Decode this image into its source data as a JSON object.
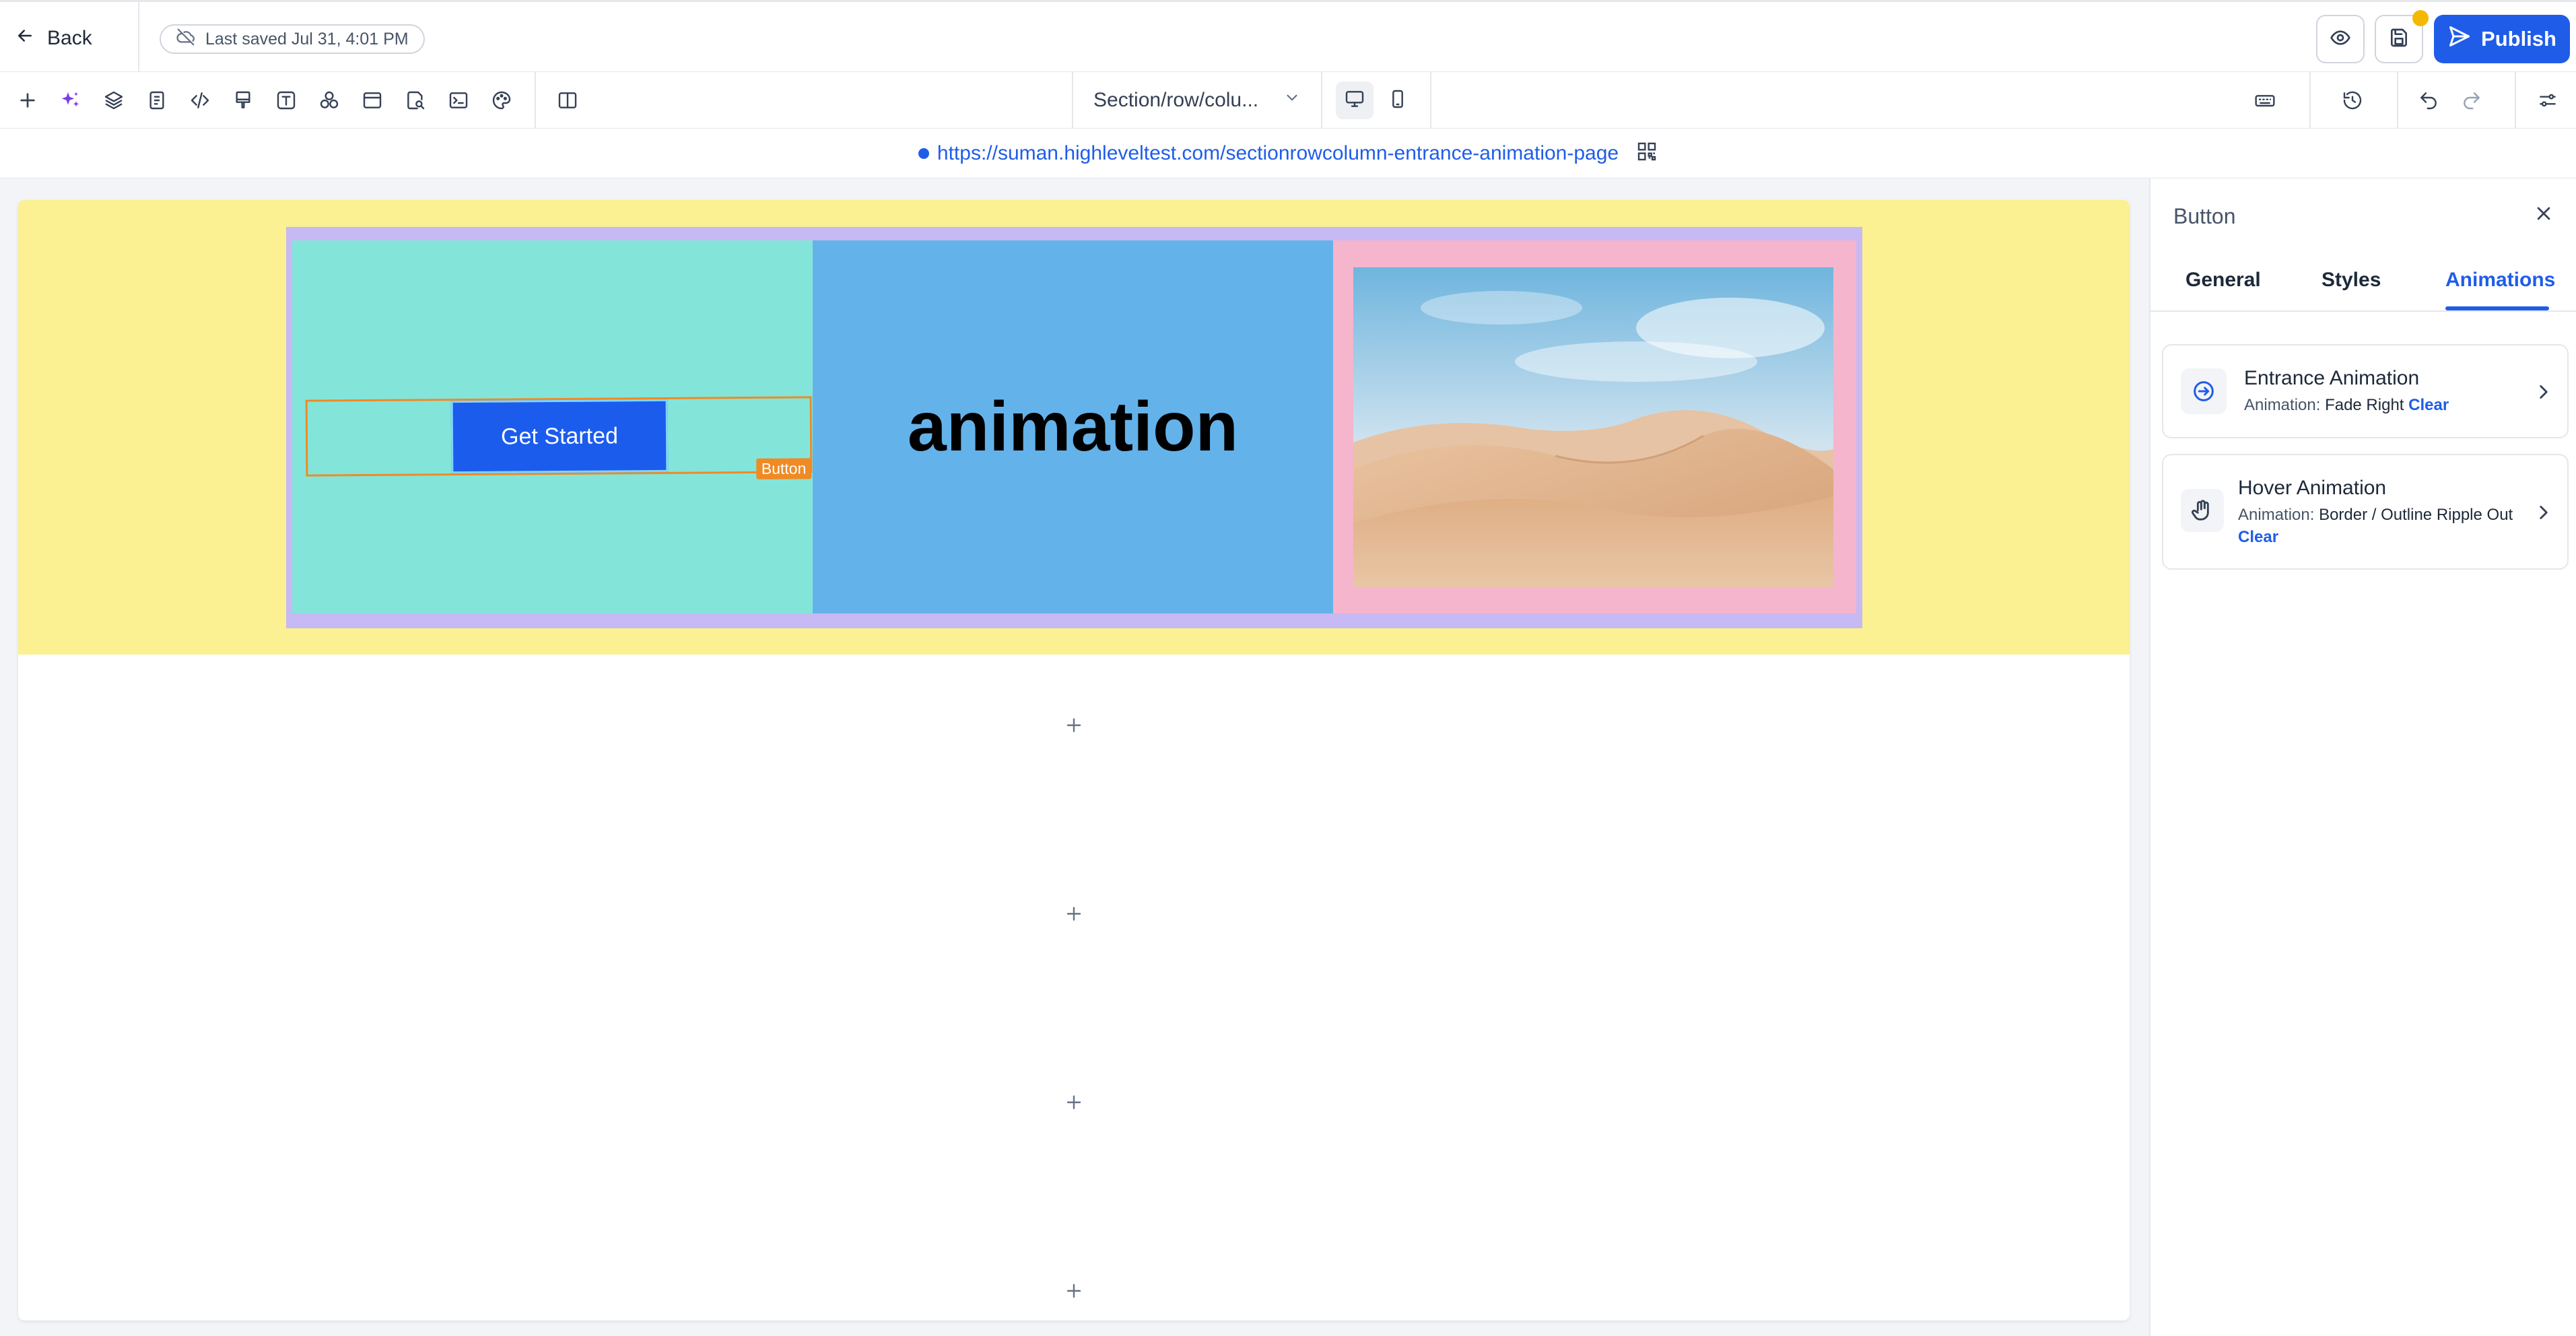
{
  "header": {
    "back_label": "Back",
    "last_saved": "Last saved Jul 31, 4:01 PM",
    "publish_label": "Publish",
    "badge_color": "#f5b800",
    "accent_color": "#1f5de8"
  },
  "toolbar": {
    "tools": [
      "add-icon",
      "ai-sparkle-icon",
      "layers-icon",
      "pages-icon",
      "code-icon",
      "paint-bucket-icon",
      "typography-icon",
      "shapes-icon",
      "layout-icon",
      "search-page-icon",
      "terminal-icon",
      "palette-icon",
      "columns-icon"
    ],
    "page_selector": "Section/row/colu...",
    "devices": [
      "desktop-icon",
      "mobile-icon"
    ],
    "right_tools": [
      "keyboard-icon",
      "history-icon",
      "undo-icon",
      "redo-icon",
      "settings-sliders-icon"
    ]
  },
  "urlbar": {
    "url": "https://suman.highleveltest.com/sectionrowcolumn-entrance-animation-page"
  },
  "canvas": {
    "section_color": "#fbf092",
    "row_color": "#c7b9f3",
    "column_colors": [
      "#83e5da",
      "#64b2ea",
      "#f5b5cc"
    ],
    "button_label": "Get Started",
    "selection_tag": "Button",
    "headline": "animation",
    "image": "desert-dunes-photo"
  },
  "panel": {
    "title": "Button",
    "tabs": [
      "General",
      "Styles",
      "Animations"
    ],
    "active_tab": "Animations",
    "cards": [
      {
        "title": "Entrance Animation",
        "label": "Animation:",
        "value": "Fade Right",
        "action": "Clear",
        "icon": "entrance-arrow-icon"
      },
      {
        "title": "Hover Animation",
        "label": "Animation:",
        "value": "Border / Outline Ripple Out",
        "action": "Clear",
        "icon": "hand-pointer-icon"
      }
    ]
  }
}
